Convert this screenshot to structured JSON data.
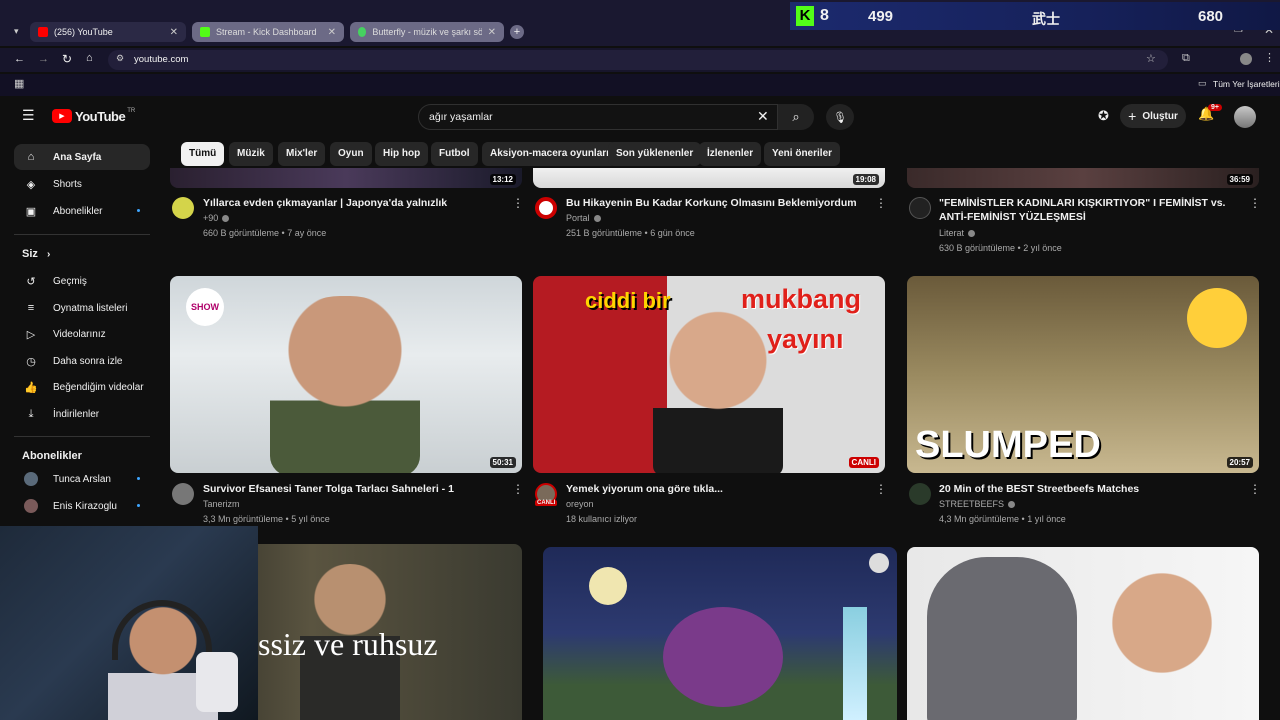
{
  "browser": {
    "tabs": [
      {
        "label": "(256) YouTube",
        "color": "#ff0000"
      },
      {
        "label": "Stream - Kick Dashboard",
        "color": "#53fc18"
      },
      {
        "label": "Butterfly - müzik ve şarkı sözle...",
        "color": "#46d160"
      }
    ],
    "url": "youtube.com",
    "bookmarks_label": "Tüm Yer İşaretleri"
  },
  "overlay": {
    "badge": "K",
    "viewers": "8",
    "stat_left": "499",
    "stat_mid": "武士",
    "stat_right": "680"
  },
  "youtube": {
    "logo_text": "YouTube",
    "logo_region": "TR",
    "search_value": "ağır yaşamlar",
    "create_label": "Oluştur",
    "notif_count": "9+",
    "chips": [
      "Tümü",
      "Müzik",
      "Mix'ler",
      "Oyun",
      "Hip hop",
      "Futbol",
      "Aksiyon-macera oyunları",
      "Son yüklenenler",
      "İzlenenler",
      "Yeni öneriler"
    ]
  },
  "sidebar": {
    "main": [
      {
        "label": "Ana Sayfa",
        "icon": "home-icon"
      },
      {
        "label": "Shorts",
        "icon": "shorts-icon"
      },
      {
        "label": "Abonelikler",
        "icon": "subscriptions-icon"
      }
    ],
    "you_header": "Siz",
    "you_items": [
      {
        "label": "Geçmiş",
        "icon": "history-icon"
      },
      {
        "label": "Oynatma listeleri",
        "icon": "playlist-icon"
      },
      {
        "label": "Videolarınız",
        "icon": "your-videos-icon"
      },
      {
        "label": "Daha sonra izle",
        "icon": "watch-later-icon"
      },
      {
        "label": "Beğendiğim videolar",
        "icon": "like-icon"
      },
      {
        "label": "İndirilenler",
        "icon": "download-icon"
      }
    ],
    "subs_header": "Abonelikler",
    "subs": [
      {
        "label": "Tunca Arslan"
      },
      {
        "label": "Enis Kirazoglu"
      }
    ]
  },
  "videos_row1": [
    {
      "title": "Yıllarca evden çıkmayanlar | Japonya'da yalnızlık",
      "channel": "+90",
      "meta": "660 B görüntüleme • 7 ay önce",
      "duration": "13:12"
    },
    {
      "title": "Bu Hikayenin Bu Kadar Korkunç Olmasını Beklemiyordum",
      "channel": "Portal",
      "meta": "251 B görüntüleme • 6 gün önce",
      "duration": "19:08"
    },
    {
      "title": "\"FEMİNİSTLER KADINLARI KIŞKIRTIYOR\" I FEMİNİST vs. ANTİ-FEMİNİST YÜZLEŞMESİ",
      "channel": "Literat",
      "meta": "630 B görüntüleme • 2 yıl önce",
      "duration": "36:59"
    }
  ],
  "videos_row2": [
    {
      "title": "Survivor Efsanesi Taner Tolga Tarlacı Sahneleri - 1",
      "channel": "Tanerizm",
      "meta": "3,3 Mn görüntüleme • 5 yıl önce",
      "duration": "50:31",
      "thumb_text": "SHOW"
    },
    {
      "title": "Yemek yiyorum ona göre tıkla...",
      "channel": "oreyon",
      "meta": "18 kullanıcı izliyor",
      "duration": "CANLI",
      "thumb_text_1": "ciddi bir",
      "thumb_text_2": "mukbang",
      "thumb_text_3": "yayını"
    },
    {
      "title": "20 Min of the BEST Streetbeefs Matches",
      "channel": "STREETBEEFS",
      "meta": "4,3 Mn görüntüleme • 1 yıl önce",
      "duration": "20:57",
      "thumb_text": "SLUMPED"
    }
  ],
  "videos_row3": [
    {
      "thumb_text": "ssiz ve ruhsuz"
    },
    {
      "thumb_text": ""
    },
    {
      "thumb_text": ""
    }
  ],
  "live_badge": "CANLI"
}
